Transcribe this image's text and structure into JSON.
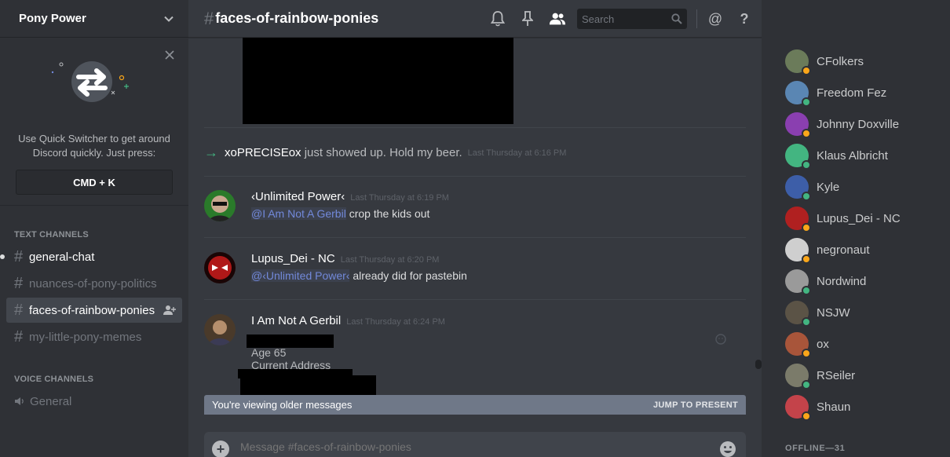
{
  "guild": {
    "name": "Pony Power"
  },
  "quick_switcher": {
    "text": "Use Quick Switcher to get around Discord quickly. Just press:",
    "shortcut": "CMD + K"
  },
  "categories": {
    "text": "TEXT CHANNELS",
    "voice": "VOICE CHANNELS"
  },
  "channels": [
    {
      "name": "general-chat",
      "state": "unread"
    },
    {
      "name": "nuances-of-pony-politics",
      "state": "muted"
    },
    {
      "name": "faces-of-rainbow-ponies",
      "state": "active"
    },
    {
      "name": "my-little-pony-memes",
      "state": "muted"
    }
  ],
  "voice_channels": [
    {
      "name": "General"
    }
  ],
  "topbar": {
    "hash": "#",
    "channel": "faces-of-rainbow-ponies",
    "search_placeholder": "Search",
    "mention": "@",
    "help": "?"
  },
  "system_message": {
    "user": "xoPRECISEox",
    "text": " just showed up. Hold my beer.",
    "timestamp": "Last Thursday at 6:16 PM"
  },
  "messages": [
    {
      "author": "‹Unlimited Power‹",
      "timestamp": "Last Thursday at 6:19 PM",
      "mention": "@I Am Not A Gerbil",
      "text": " crop the kids out"
    },
    {
      "author": "Lupus_Dei - NC",
      "timestamp": "Last Thursday at 6:20 PM",
      "mention": "@‹Unlimited Power‹",
      "text": " already did for pastebin"
    },
    {
      "author": "I Am Not A Gerbil",
      "timestamp": "Last Thursday at 6:24 PM",
      "lines": [
        "Age 65",
        "Current Address"
      ]
    }
  ],
  "older_banner": {
    "text": "You're viewing older messages",
    "jump": "JUMP TO PRESENT"
  },
  "composer": {
    "placeholder": "Message #faces-of-rainbow-ponies"
  },
  "members": [
    {
      "name": "CFolkers",
      "status": "idle",
      "color": "#6b7b5a"
    },
    {
      "name": "Freedom Fez",
      "status": "online",
      "color": "#5a86b3"
    },
    {
      "name": "Johnny Doxville",
      "status": "idle",
      "color": "#8a3fb0"
    },
    {
      "name": "Klaus Albricht",
      "status": "online",
      "color": "#43b581"
    },
    {
      "name": "Kyle",
      "status": "online",
      "color": "#3d5ea8"
    },
    {
      "name": "Lupus_Dei - NC",
      "status": "idle",
      "color": "#b02020"
    },
    {
      "name": "negronaut",
      "status": "idle",
      "color": "#cfcfcf"
    },
    {
      "name": "Nordwind",
      "status": "online",
      "color": "#9a9a9a"
    },
    {
      "name": "NSJW",
      "status": "online",
      "color": "#5b5346"
    },
    {
      "name": "ox",
      "status": "idle",
      "color": "#a8553a"
    },
    {
      "name": "RSeiler",
      "status": "online",
      "color": "#7b7b6a"
    },
    {
      "name": "Shaun",
      "status": "idle",
      "color": "#c4434a"
    }
  ],
  "offline_header": "OFFLINE—31",
  "colors": {
    "online": "#43b581",
    "idle": "#faa61a",
    "accent": "#7289da"
  }
}
